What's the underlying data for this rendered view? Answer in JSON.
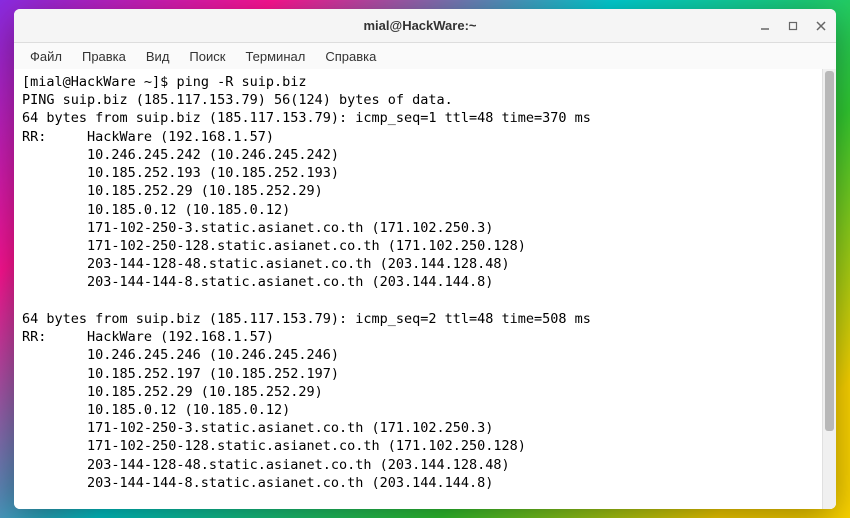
{
  "window": {
    "title": "mial@HackWare:~"
  },
  "menu": {
    "file": "Файл",
    "edit": "Правка",
    "view": "Вид",
    "search": "Поиск",
    "terminal": "Терминал",
    "help": "Справка"
  },
  "prompt": "[mial@HackWare ~]$ ",
  "command": "ping -R suip.biz",
  "lines": [
    "PING suip.biz (185.117.153.79) 56(124) bytes of data.",
    "64 bytes from suip.biz (185.117.153.79): icmp_seq=1 ttl=48 time=370 ms",
    "RR:     HackWare (192.168.1.57)",
    "        10.246.245.242 (10.246.245.242)",
    "        10.185.252.193 (10.185.252.193)",
    "        10.185.252.29 (10.185.252.29)",
    "        10.185.0.12 (10.185.0.12)",
    "        171-102-250-3.static.asianet.co.th (171.102.250.3)",
    "        171-102-250-128.static.asianet.co.th (171.102.250.128)",
    "        203-144-128-48.static.asianet.co.th (203.144.128.48)",
    "        203-144-144-8.static.asianet.co.th (203.144.144.8)",
    "",
    "64 bytes from suip.biz (185.117.153.79): icmp_seq=2 ttl=48 time=508 ms",
    "RR:     HackWare (192.168.1.57)",
    "        10.246.245.246 (10.246.245.246)",
    "        10.185.252.197 (10.185.252.197)",
    "        10.185.252.29 (10.185.252.29)",
    "        10.185.0.12 (10.185.0.12)",
    "        171-102-250-3.static.asianet.co.th (171.102.250.3)",
    "        171-102-250-128.static.asianet.co.th (171.102.250.128)",
    "        203-144-128-48.static.asianet.co.th (203.144.128.48)",
    "        203-144-144-8.static.asianet.co.th (203.144.144.8)",
    ""
  ]
}
